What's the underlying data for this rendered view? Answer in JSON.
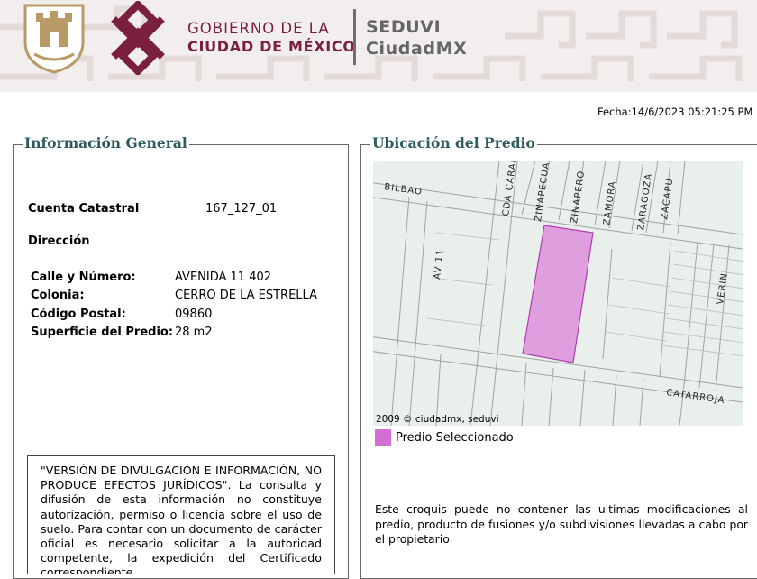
{
  "header": {
    "gob_line1": "GOBIERNO DE LA",
    "gob_line2": "CIUDAD DE MÉXICO",
    "seduvi_line1": "SEDUVI",
    "seduvi_line2": "CiudadMX",
    "brand_color": "#7a1f3d",
    "shield_color": "#b99a66"
  },
  "fecha": "Fecha:14/6/2023 05:21:25 PM",
  "info": {
    "legend": "Información General",
    "cuenta_label": "Cuenta Catastral",
    "cuenta_value": "167_127_01",
    "direccion_label": "Dirección",
    "rows": [
      {
        "label": "Calle y Número:",
        "value": "AVENIDA 11 402"
      },
      {
        "label": "Colonia:",
        "value": "CERRO DE LA ESTRELLA"
      },
      {
        "label": "Código Postal:",
        "value": "09860"
      },
      {
        "label": "Superficie del Predio:",
        "value": "28 m2"
      }
    ],
    "disclaimer": "\"VERSIÓN DE DIVULGACIÓN E INFORMACIÓN, NO PRODUCE EFECTOS JURÍDICOS\". La consulta y difusión de esta información no constituye autorización, permiso o licencia sobre el uso de suelo. Para contar con un documento de carácter oficial es necesario solicitar a la autoridad competente, la expedición del Certificado correspondiente."
  },
  "ubicacion": {
    "legend": "Ubicación del Predio",
    "streets": {
      "bilbao": "BILBAO",
      "cda_carai": "CDA CARAI",
      "zinapecua": "ZINAPECUA",
      "zinapero": "ZINAPERO",
      "zamora": "ZAMORA",
      "zaragoza": "ZARAGOZA",
      "zacapu": "ZACAPU",
      "av11": "AV 11",
      "verin": "VERIN",
      "catarroja": "CATARROJA"
    },
    "copyright": "2009 © ciudadmx, seduvi",
    "legend_swatch_color": "#d36fd3",
    "legend_item": "Predio Seleccionado",
    "note": "Este croquis puede no contener las ultimas modificaciones al predio, producto de fusiones y/o subdivisiones llevadas a cabo por el propietario."
  }
}
